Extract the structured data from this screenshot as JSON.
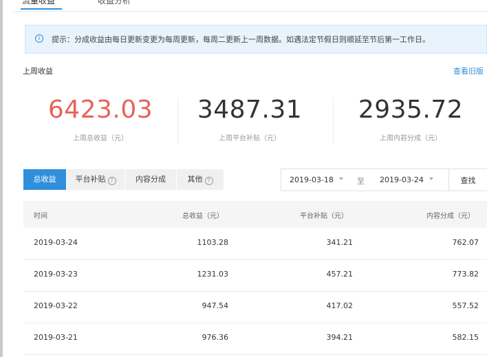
{
  "tabs": [
    "流量收益",
    "收益分析"
  ],
  "notice": {
    "icon": "info-icon",
    "text": "提示：分成收益由每日更新变更为每周更新，每周二更新上一周数据。如遇法定节假日则顺延至节后第一工作日。"
  },
  "section": {
    "title": "上周收益",
    "link": "查看旧版 >"
  },
  "stats": [
    {
      "value": "6423.03",
      "label": "上周总收益（元）"
    },
    {
      "value": "3487.31",
      "label": "上周平台补贴（元）"
    },
    {
      "value": "2935.72",
      "label": "上周内容分成（元）"
    }
  ],
  "filter_tabs": [
    "总收益",
    "平台补贴",
    "内容分成",
    "其他"
  ],
  "date_range": {
    "start": "2019-03-18",
    "separator": "至",
    "end": "2019-03-24",
    "search": "查找"
  },
  "table": {
    "headers": [
      "时间",
      "总收益（元）",
      "平台补贴（元）",
      "内容分成（元）"
    ],
    "rows": [
      [
        "2019-03-24",
        "1103.28",
        "341.21",
        "762.07"
      ],
      [
        "2019-03-23",
        "1231.03",
        "457.21",
        "773.82"
      ],
      [
        "2019-03-22",
        "947.54",
        "417.02",
        "557.52"
      ],
      [
        "2019-03-21",
        "976.36",
        "394.21",
        "582.15"
      ]
    ]
  },
  "colors": {
    "accent": "#2f8fdc",
    "highlight": "#e8625a"
  }
}
